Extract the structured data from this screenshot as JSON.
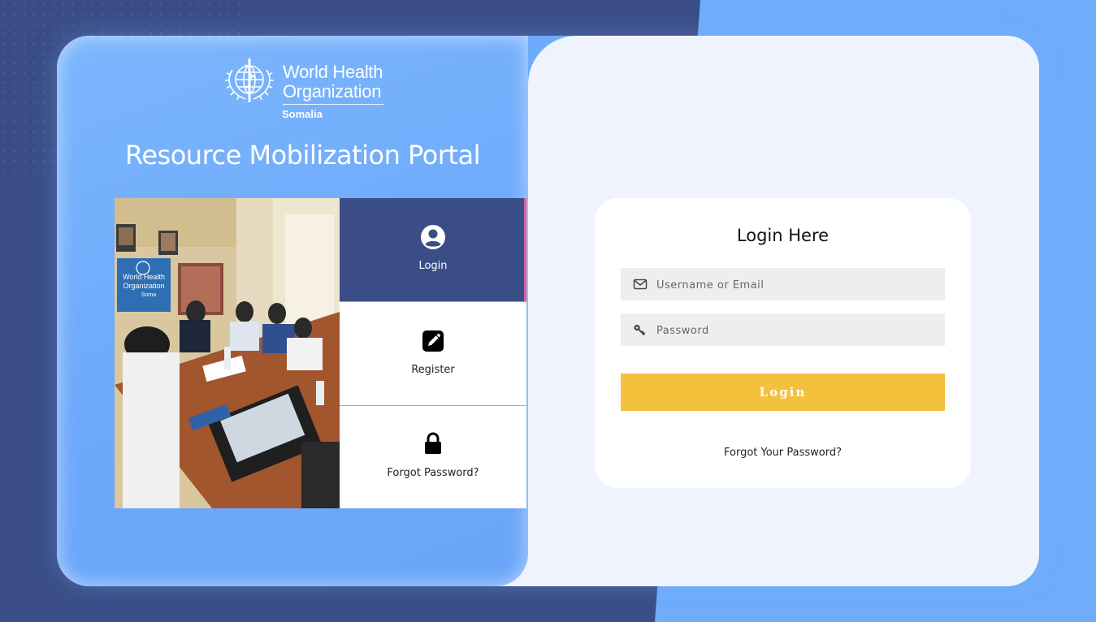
{
  "brand": {
    "org_line1": "World Health",
    "org_line2": "Organization",
    "country": "Somalia",
    "portal_title": "Resource Mobilization Portal"
  },
  "photo": {
    "banner_text_line1": "World Health",
    "banner_text_line2": "Organization",
    "banner_text_line3": "Soma"
  },
  "nav": {
    "items": [
      {
        "label": "Login",
        "icon": "user-circle-icon",
        "active": true
      },
      {
        "label": "Register",
        "icon": "pencil-square-icon",
        "active": false
      },
      {
        "label": "Forgot Password?",
        "icon": "lock-icon",
        "active": false
      }
    ]
  },
  "login_form": {
    "heading": "Login Here",
    "username_placeholder": "Username or Email",
    "password_placeholder": "Password",
    "username_icon": "envelope-icon",
    "password_icon": "key-icon",
    "submit_label": "Login",
    "forgot_label": "Forgot Your Password?"
  },
  "colors": {
    "navy": "#3a4d86",
    "sky": "#6fadfb",
    "accent_pink": "#e0629a",
    "button_yellow": "#f4c13d"
  }
}
